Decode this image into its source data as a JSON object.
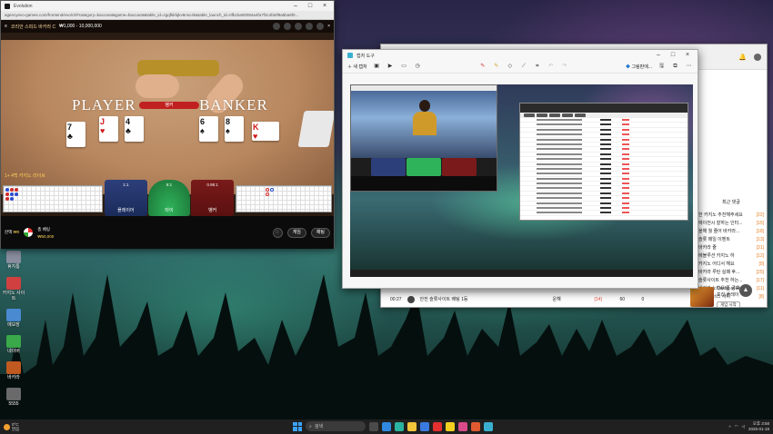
{
  "casino_window": {
    "title": "Evolution",
    "address": "agencyevo-games.com/frontend/evo/r2/#category=baccarat&game=baccarat&table_id=zgqfkkfqkv6nsc4k&table_launch_id=0fb1ba00084a4fa7f3c4fa0f9a5ba5f0...",
    "game_title": "코리안 스피드 바카라 C",
    "bet_limits": "₩1,000 - 10,000,000",
    "label_player": "PLAYER",
    "label_banker": "BANKER",
    "result_label": "뱅커",
    "player_cards": [
      {
        "rank": "7",
        "suit": "♣",
        "color": "black"
      },
      {
        "rank": "J",
        "suit": "♥",
        "color": "red"
      },
      {
        "rank": "4",
        "suit": "♣",
        "color": "black"
      }
    ],
    "banker_cards": [
      {
        "rank": "6",
        "suit": "♠",
        "color": "black"
      },
      {
        "rank": "8",
        "suit": "♠",
        "color": "black"
      },
      {
        "rank": "K",
        "suit": "♥",
        "color": "red"
      }
    ],
    "dealer_status": "1+ 4백 카지노 라이브",
    "bets": {
      "player_label": "플레이어",
      "tie_label": "타이",
      "banker_label": "뱅커",
      "player_odds": "1:1",
      "tie_odds": "8:1",
      "banker_odds": "0.95:1"
    },
    "balance_label": "잔액",
    "balance_amount": "₩0",
    "total_bet_label": "총 베팅",
    "total_bet_amount": "₩50,000",
    "btn_more_games": "게임",
    "btn_chat": "채팅",
    "accent_red": "#c02020",
    "accent_gold": "#ffd55a"
  },
  "snip_window": {
    "title": "캡처 도구",
    "new_label": "새 캡처",
    "share_label": "그림판에...",
    "icons": [
      "new-icon",
      "camera-icon",
      "video-icon",
      "crop-icon",
      "undo-icon",
      "redo-icon",
      "save-icon",
      "copy-icon",
      "more-icon"
    ]
  },
  "browser_window": {
    "right_header": "최근 댓글",
    "view_more_label": "더보기",
    "recent_items": [
      {
        "text": "한 카지노 추천해주세요",
        "num": "[22]"
      },
      {
        "text": "에이전시 잘하는 인터...",
        "num": "[15]"
      },
      {
        "text": "올해 월 줄어 바카라...",
        "num": "[18]"
      },
      {
        "text": "슬롯 매일 이벤트",
        "num": "[13]"
      },
      {
        "text": "바카라 줄",
        "num": "[31]"
      },
      {
        "text": "에볼루션 카지노 하",
        "num": "[12]"
      },
      {
        "text": "카지노 어디서 해요",
        "num": "[9]"
      },
      {
        "text": "바카라 루틴 실패 후...",
        "num": "[25]"
      },
      {
        "text": "슬롯사이트 추천 하는...",
        "num": "[17]"
      },
      {
        "text": "바카라 노하우 좀 공유",
        "num": "[11]"
      },
      {
        "text": "슬롯 보너스 사이",
        "num": "[8]"
      }
    ],
    "bottom_row": {
      "time": "00:27",
      "title": "안전 슬롯사이트 배팅 1등",
      "user": "운해",
      "num": "[14]",
      "views": "60",
      "likes": "0"
    },
    "ad_title": "Castle of Fire",
    "ad_sub": "프리 플레이",
    "ad_cta": "게임 시작",
    "scroll_top_label": "▲"
  },
  "desktop": {
    "icons": [
      {
        "label": "휴지통",
        "color": "#8a8fa0"
      },
      {
        "label": "카지노 사이트",
        "color": "#d04040"
      },
      {
        "label": "메모장",
        "color": "#4a8ad0"
      },
      {
        "label": "네이버",
        "color": "#3aa94a"
      },
      {
        "label": "바카라",
        "color": "#c05a20"
      },
      {
        "label": "5555",
        "color": "#6a6a6a"
      }
    ]
  },
  "taskbar": {
    "temp": "0°C",
    "weather": "맑음",
    "search_placeholder": "검색",
    "time": "오후 3:58",
    "date": "2025-01-18",
    "apps": [
      {
        "name": "task-view-icon",
        "color": "#4a4a4a"
      },
      {
        "name": "chrome-icon",
        "color": "#2f8ae0"
      },
      {
        "name": "edge-icon",
        "color": "#2ab3a0"
      },
      {
        "name": "file-explorer-icon",
        "color": "#f2c53a"
      },
      {
        "name": "store-icon",
        "color": "#3a7ae0"
      },
      {
        "name": "youtube-icon",
        "color": "#e53030"
      },
      {
        "name": "kakaotalk-icon",
        "color": "#f5d020"
      },
      {
        "name": "instagram-icon",
        "color": "#d84a8a"
      },
      {
        "name": "browser-icon",
        "color": "#e05a30"
      },
      {
        "name": "snipping-tool-icon",
        "color": "#3ab0d0"
      }
    ]
  }
}
